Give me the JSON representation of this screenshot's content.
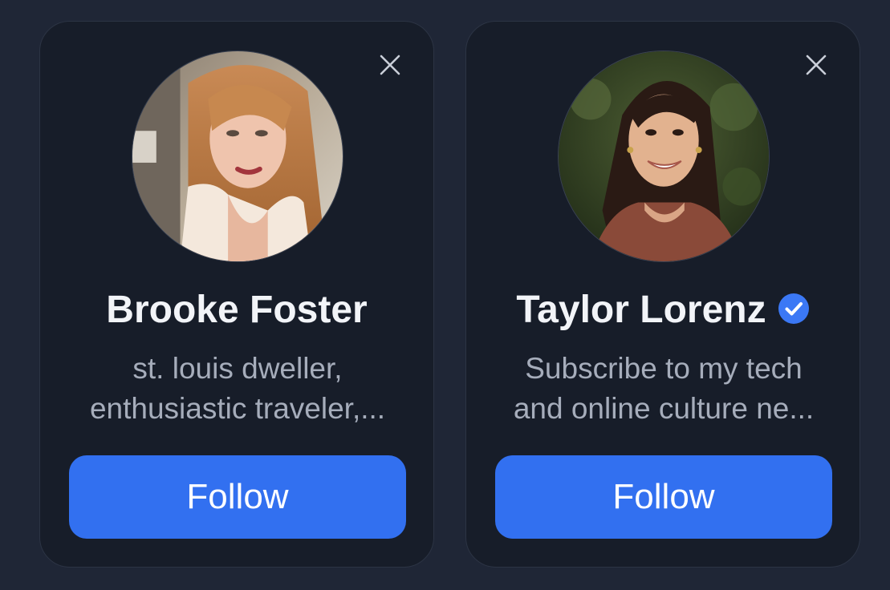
{
  "cards": [
    {
      "name": "Brooke Foster",
      "bio_line1": "st. louis dweller,",
      "bio_line2": "enthusiastic traveler,...",
      "follow_label": "Follow",
      "verified": false
    },
    {
      "name": "Taylor Lorenz",
      "bio_line1": "Subscribe to my tech",
      "bio_line2": "and online culture ne...",
      "follow_label": "Follow",
      "verified": true
    }
  ],
  "icons": {
    "close": "close-icon",
    "verified": "verified-check-icon"
  },
  "colors": {
    "page_background": "#1f2636",
    "card_background": "#171d29",
    "accent": "#3270f0",
    "name_text": "#f2f4f8",
    "bio_text": "#a6adbb",
    "verified_badge": "#3b78f5"
  }
}
